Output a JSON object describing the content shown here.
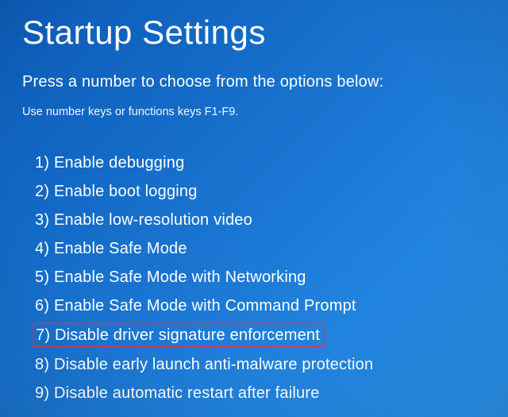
{
  "title": "Startup Settings",
  "instruction": "Press a number to choose from the options below:",
  "hint": "Use number keys or functions keys F1-F9.",
  "options": [
    {
      "num": "1",
      "label": "Enable debugging",
      "highlighted": false
    },
    {
      "num": "2",
      "label": "Enable boot logging",
      "highlighted": false
    },
    {
      "num": "3",
      "label": "Enable low-resolution video",
      "highlighted": false
    },
    {
      "num": "4",
      "label": "Enable Safe Mode",
      "highlighted": false
    },
    {
      "num": "5",
      "label": "Enable Safe Mode with Networking",
      "highlighted": false
    },
    {
      "num": "6",
      "label": "Enable Safe Mode with Command Prompt",
      "highlighted": false
    },
    {
      "num": "7",
      "label": "Disable driver signature enforcement",
      "highlighted": true
    },
    {
      "num": "8",
      "label": "Disable early launch anti-malware protection",
      "highlighted": false
    },
    {
      "num": "9",
      "label": "Disable automatic restart after failure",
      "highlighted": false
    }
  ]
}
